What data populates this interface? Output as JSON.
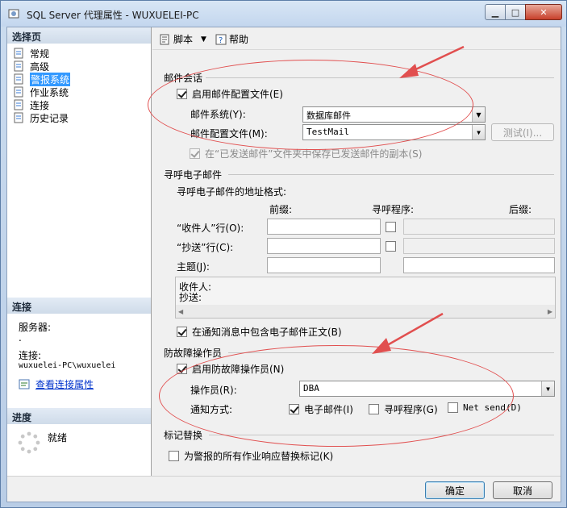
{
  "window": {
    "title": "SQL Server 代理属性 - WUXUELEI-PC",
    "min_label": "▁",
    "max_label": "□",
    "close_label": "✕"
  },
  "sidebar": {
    "pages_header": "选择页",
    "pages": [
      {
        "label": "常规",
        "selected": false
      },
      {
        "label": "高级",
        "selected": false
      },
      {
        "label": "警报系统",
        "selected": true
      },
      {
        "label": "作业系统",
        "selected": false
      },
      {
        "label": "连接",
        "selected": false
      },
      {
        "label": "历史记录",
        "selected": false
      }
    ],
    "connection_header": "连接",
    "server_label": "服务器:",
    "server_value": ".",
    "connection_label": "连接:",
    "connection_value": "wuxuelei-PC\\wuxuelei",
    "view_link": "查看连接属性",
    "progress_header": "进度",
    "progress_status": "就绪"
  },
  "toolbar": {
    "script_label": "脚本",
    "help_label": "帮助"
  },
  "mail": {
    "group_title": "邮件会话",
    "enable_label": "启用邮件配置文件(E)",
    "enable_checked": true,
    "system_label": "邮件系统(Y):",
    "system_value": "数据库邮件",
    "profile_label": "邮件配置文件(M):",
    "profile_value": "TestMail",
    "test_button": "测试(I)...",
    "save_copy_label": "在“已发送邮件”文件夹中保存已发送邮件的副本(S)",
    "save_copy_checked": true
  },
  "pager": {
    "group_title": "寻呼电子邮件",
    "format_label": "寻呼电子邮件的地址格式:",
    "col_prefix": "前缀:",
    "col_pager": "寻呼程序:",
    "col_suffix": "后缀:",
    "to_label": "“收件人”行(O):",
    "cc_label": "“抄送”行(C):",
    "subject_label": "主题(J):",
    "preview_to": "收件人:",
    "preview_cc": "抄送:",
    "include_body_label": "在通知消息中包含电子邮件正文(B)",
    "include_body_checked": true
  },
  "failsafe": {
    "group_title": "防故障操作员",
    "enable_label": "启用防故障操作员(N)",
    "enable_checked": true,
    "operator_label": "操作员(R):",
    "operator_value": "DBA",
    "notify_label": "通知方式:",
    "email_label": "电子邮件(I)",
    "email_checked": true,
    "pager_label": "寻呼程序(G)",
    "pager_checked": false,
    "netsend_label": "Net send(D)",
    "netsend_checked": false
  },
  "token": {
    "group_title": "标记替换",
    "replace_label": "为警报的所有作业响应替换标记(K)",
    "replace_checked": false
  },
  "buttons": {
    "ok": "确定",
    "cancel": "取消"
  },
  "colors": {
    "annotation": "#e14f4f",
    "selection": "#3399ff",
    "link": "#0033cc"
  }
}
